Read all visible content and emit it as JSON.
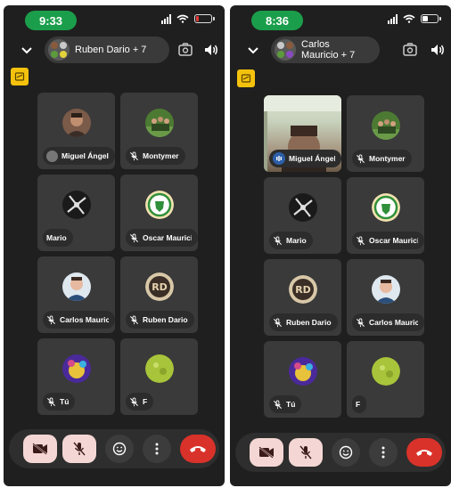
{
  "screens": [
    {
      "status": {
        "time": "9:33",
        "battery": "low"
      },
      "header": {
        "title": "Ruben Dario + 7"
      },
      "participants": [
        {
          "name": "Miguel Ángel",
          "avatar": "photo-man-dark",
          "mic": "speaking-avatar"
        },
        {
          "name": "Montymer",
          "avatar": "photo-group-green",
          "mic": "muted"
        },
        {
          "name": "Mario",
          "avatar": "logo-spiral",
          "mic": "none"
        },
        {
          "name": "Oscar Mauricio",
          "avatar": "logo-green-badge",
          "mic": "muted"
        },
        {
          "name": "Carlos Mauricio",
          "avatar": "photo-man-light",
          "mic": "muted"
        },
        {
          "name": "Ruben Dario",
          "avatar": "logo-rd",
          "mic": "muted"
        },
        {
          "name": "Tú",
          "avatar": "photo-purple",
          "mic": "muted"
        },
        {
          "name": "F",
          "avatar": "photo-lime",
          "mic": "muted"
        }
      ]
    },
    {
      "status": {
        "time": "8:36",
        "battery": "half"
      },
      "header": {
        "title": "Carlos Mauricio + 7"
      },
      "participants": [
        {
          "name": "Miguel Ángel",
          "avatar": "video",
          "mic": "speaking"
        },
        {
          "name": "Montymer",
          "avatar": "photo-group-green",
          "mic": "muted"
        },
        {
          "name": "Mario",
          "avatar": "logo-spiral",
          "mic": "muted"
        },
        {
          "name": "Oscar Mauricio",
          "avatar": "logo-green-badge",
          "mic": "muted"
        },
        {
          "name": "Ruben Dario",
          "avatar": "logo-rd",
          "mic": "muted"
        },
        {
          "name": "Carlos Mauricio",
          "avatar": "photo-man-light",
          "mic": "muted"
        },
        {
          "name": "Tú",
          "avatar": "photo-purple",
          "mic": "muted"
        },
        {
          "name": "F",
          "avatar": "photo-lime",
          "mic": "none"
        }
      ]
    }
  ],
  "colors": {
    "accent_green": "#1b9e4b",
    "end_call": "#d9322a",
    "tile": "#3a3a3a",
    "badge": "#f4c20d"
  }
}
